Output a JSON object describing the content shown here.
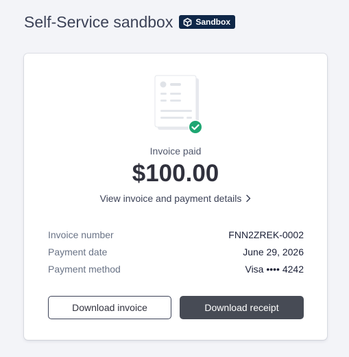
{
  "header": {
    "title": "Self-Service sandbox",
    "badge": {
      "label": "Sandbox",
      "icon": "cube-icon",
      "background": "#0f2748"
    }
  },
  "invoice": {
    "icon": "invoice-document-icon",
    "status_icon": "check-circle-icon",
    "status_color": "#1ea672",
    "status": "Invoice paid",
    "amount": "$100.00",
    "details_link": "View invoice and payment details",
    "details_link_icon": "chevron-right-icon"
  },
  "details": [
    {
      "label": "Invoice number",
      "value": "FNN2ZREK-0002"
    },
    {
      "label": "Payment date",
      "value": "June 29, 2026"
    },
    {
      "label": "Payment method",
      "value": "Visa •••• 4242"
    }
  ],
  "actions": {
    "download_invoice": "Download invoice",
    "download_receipt": "Download receipt",
    "primary_color": "#474b55"
  }
}
